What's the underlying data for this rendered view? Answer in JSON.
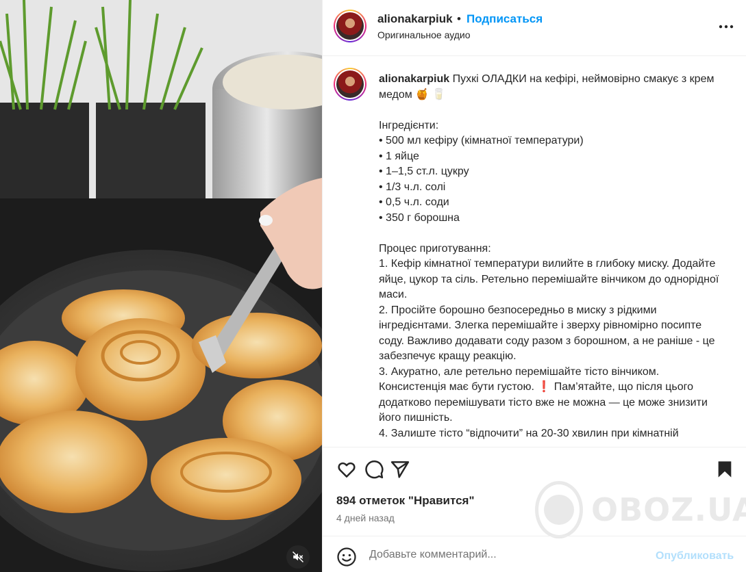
{
  "post": {
    "username": "alionakarpiuk",
    "separator": "•",
    "follow_label": "Подписаться",
    "audio_label": "Оригинальное аудио",
    "caption": {
      "username": "alionakarpiuk",
      "lines": [
        "Пухкі ОЛАДКИ на кефірі, неймовірно смакує з крем медом 🍯 🥛",
        "",
        "Інгредієнти:",
        "• 500 мл кефіру (кімнатної температури)",
        "• 1 яйце",
        "• 1–1,5 ст.л. цукру",
        "• 1/3 ч.л. солі",
        "• 0,5 ч.л. соди",
        "• 350 г борошна",
        "",
        "Процес приготування:",
        "1. Кефір кімнатної температури вилийте в глибоку миску. Додайте яйце, цукор та сіль. Ретельно перемішайте вінчиком до однорідної маси.",
        "2. Просійте борошно безпосередньо в миску з рідкими інгредієнтами. Злегка перемішайте і зверху рівномірно посипте соду. Важливо додавати соду разом з борошном, а не раніше - це забезпечує кращу реакцію.",
        "3. Акуратно, але ретельно перемішайте тісто вінчиком. Консистенція має бути густою. ❗ Пам’ятайте, що після цього додатково перемішувати тісто вже не можна — це може знизити його пишність.",
        "4. Залиште тісто “відпочити” на 20-30 хвилин при кімнатній"
      ]
    },
    "likes_text": "894 отметок \"Нравится\"",
    "date_text": "4 дней назад",
    "comment_placeholder": "Добавьте комментарий...",
    "publish_label": "Опубликовать",
    "watermark_text": "OBOZ.UA"
  },
  "icons": {
    "like": "heart-icon",
    "comment": "comment-icon",
    "share": "send-icon",
    "save": "bookmark-icon",
    "emoji": "smiley-icon",
    "more": "more-horizontal-icon",
    "mute": "speaker-muted-icon"
  },
  "colors": {
    "accent": "#0095f6",
    "publish_disabled": "#b2dffc",
    "text": "#262626",
    "muted": "#737373"
  }
}
